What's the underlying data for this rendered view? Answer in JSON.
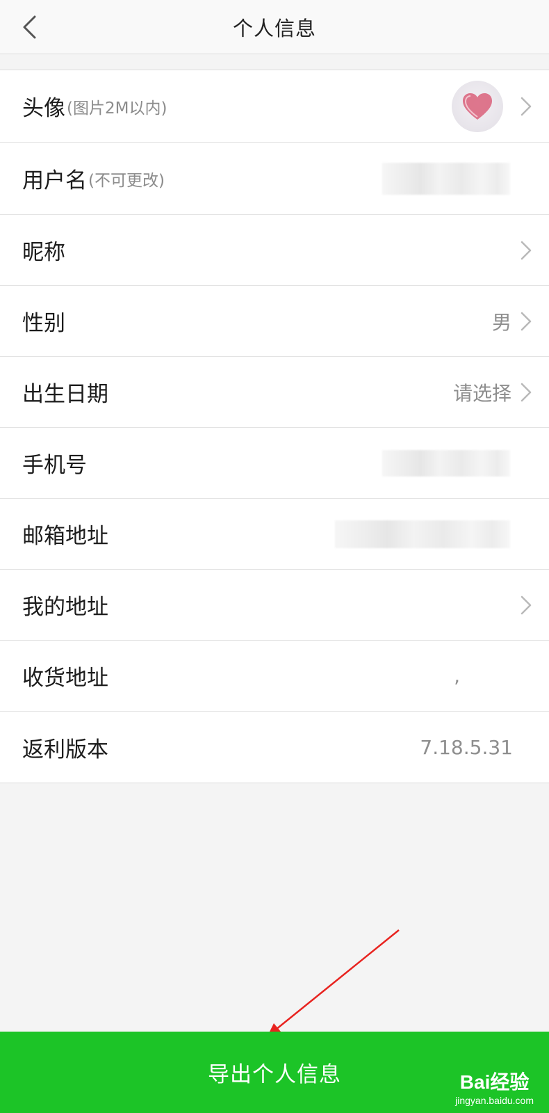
{
  "header": {
    "title": "个人信息",
    "back_icon": "chevron-left-icon"
  },
  "rows": [
    {
      "label": "头像",
      "hint": "(图片2M以内)",
      "value": "",
      "has_arrow": true
    },
    {
      "label": "用户名",
      "hint": "(不可更改)",
      "value": "",
      "has_arrow": false
    },
    {
      "label": "昵称",
      "hint": "",
      "value": "",
      "has_arrow": true
    },
    {
      "label": "性别",
      "hint": "",
      "value": "男",
      "has_arrow": true
    },
    {
      "label": "出生日期",
      "hint": "",
      "value": "请选择",
      "has_arrow": true
    },
    {
      "label": "手机号",
      "hint": "",
      "value": "",
      "has_arrow": false
    },
    {
      "label": "邮箱地址",
      "hint": "",
      "value": "",
      "has_arrow": false
    },
    {
      "label": "我的地址",
      "hint": "",
      "value": "",
      "has_arrow": true
    },
    {
      "label": "收货地址",
      "hint": "",
      "value": ",",
      "has_arrow": false
    },
    {
      "label": "返利版本",
      "hint": "",
      "value": "7.18.5.31",
      "has_arrow": false
    }
  ],
  "footer": {
    "button_label": "导出个人信息"
  },
  "watermark": {
    "main": "Bai经验",
    "sub": "jingyan.baidu.com"
  },
  "colors": {
    "accent_green": "#1cc427",
    "annotation_red": "#e8231f"
  }
}
